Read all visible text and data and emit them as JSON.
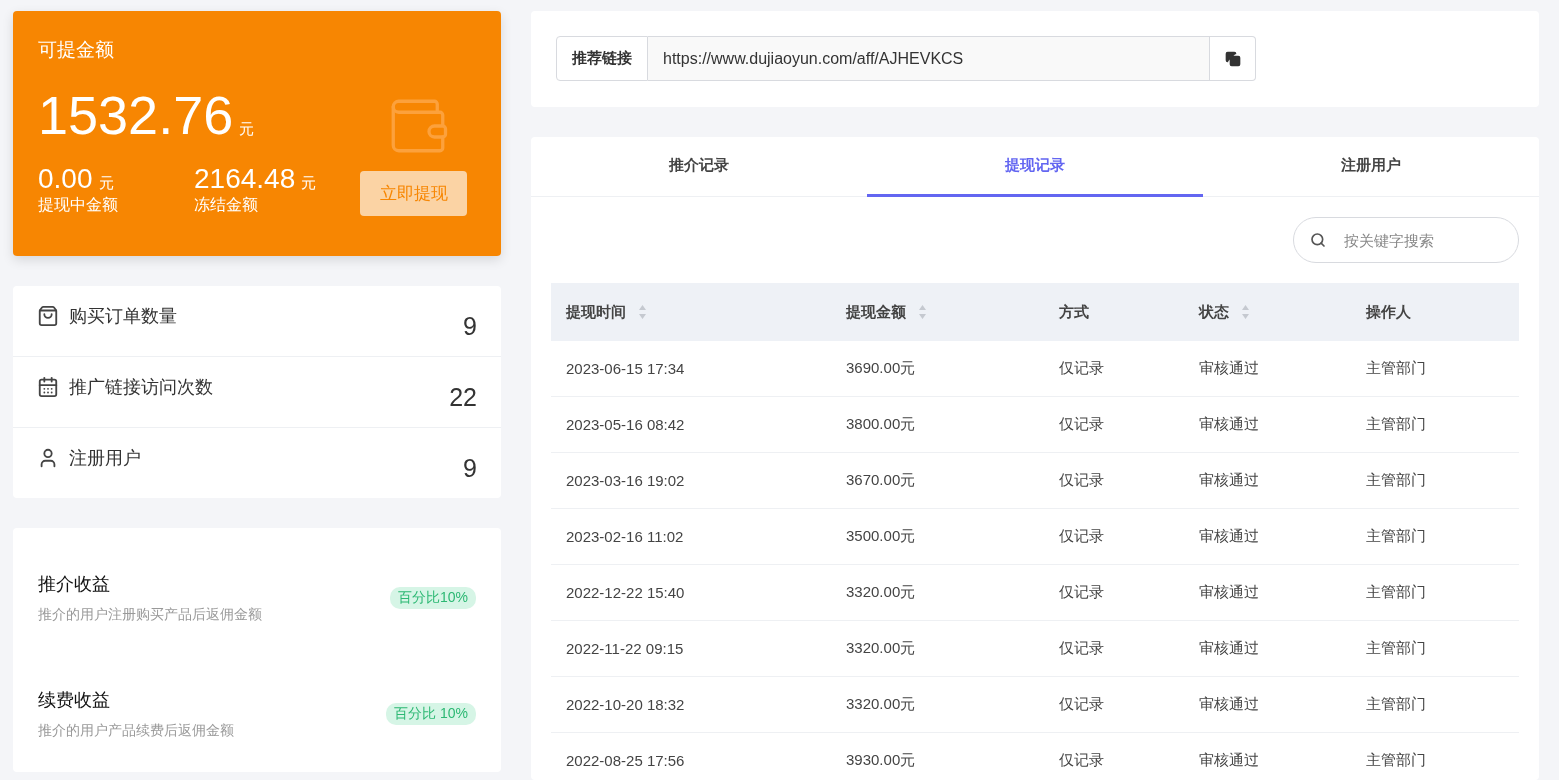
{
  "balance_card": {
    "title": "可提金额",
    "amount": "1532.76",
    "unit": "元",
    "stats": [
      {
        "value": "0.00",
        "unit": "元",
        "label": "提现中金额"
      },
      {
        "value": "2164.48",
        "unit": "元",
        "label": "冻结金额"
      }
    ],
    "button": "立即提现"
  },
  "counters": [
    {
      "kind": "bag",
      "label": "购买订单数量",
      "value": "9"
    },
    {
      "kind": "calendar",
      "label": "推广链接访问次数",
      "value": "22"
    },
    {
      "kind": "user",
      "label": "注册用户",
      "value": "9"
    }
  ],
  "earnings": [
    {
      "title": "推介收益",
      "description": "推介的用户注册购买产品后返佣金额",
      "badge": "百分比10%"
    },
    {
      "title": "续费收益",
      "description": "推介的用户产品续费后返佣金额",
      "badge": "百分比 10%"
    }
  ],
  "referral_link": {
    "label": "推荐链接",
    "value": "https://www.dujiaoyun.com/aff/AJHEVKCS"
  },
  "tabs": [
    {
      "label": "推介记录",
      "selected": false
    },
    {
      "label": "提现记录",
      "selected": true
    },
    {
      "label": "注册用户",
      "selected": false
    }
  ],
  "search": {
    "placeholder": "按关键字搜索"
  },
  "table": {
    "columns": [
      {
        "label": "提现时间",
        "sortable": true
      },
      {
        "label": "提现金额",
        "sortable": true
      },
      {
        "label": "方式",
        "sortable": false
      },
      {
        "label": "状态",
        "sortable": true
      },
      {
        "label": "操作人",
        "sortable": false
      }
    ],
    "rows": [
      [
        "2023-06-15 17:34",
        "3690.00元",
        "仅记录",
        "审核通过",
        "主管部门"
      ],
      [
        "2023-05-16 08:42",
        "3800.00元",
        "仅记录",
        "审核通过",
        "主管部门"
      ],
      [
        "2023-03-16 19:02",
        "3670.00元",
        "仅记录",
        "审核通过",
        "主管部门"
      ],
      [
        "2023-02-16 11:02",
        "3500.00元",
        "仅记录",
        "审核通过",
        "主管部门"
      ],
      [
        "2022-12-22 15:40",
        "3320.00元",
        "仅记录",
        "审核通过",
        "主管部门"
      ],
      [
        "2022-11-22 09:15",
        "3320.00元",
        "仅记录",
        "审核通过",
        "主管部门"
      ],
      [
        "2022-10-20 18:32",
        "3320.00元",
        "仅记录",
        "审核通过",
        "主管部门"
      ],
      [
        "2022-08-25 17:56",
        "3930.00元",
        "仅记录",
        "审核通过",
        "主管部门"
      ]
    ]
  }
}
